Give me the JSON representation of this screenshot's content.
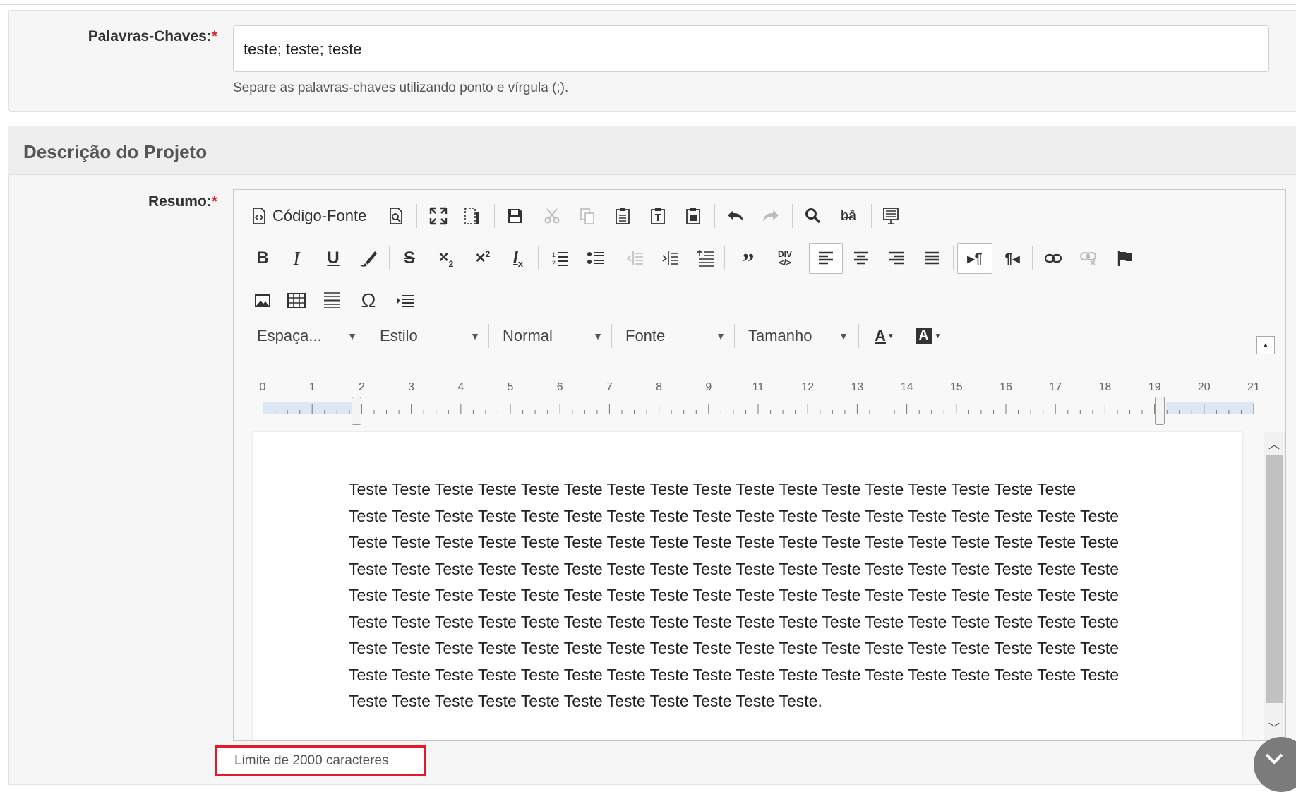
{
  "keywords": {
    "label": "Palavras-Chaves:",
    "required_mark": "*",
    "value": "teste; teste; teste",
    "help": "Separe as palavras-chaves utilizando ponto e vírgula (;)."
  },
  "section": {
    "title": "Descrição do Projeto"
  },
  "resumo": {
    "label": "Resumo:",
    "required_mark": "*",
    "limit_text": "Limite de 2000 caracteres"
  },
  "toolbar": {
    "source_label": "Código-Fonte",
    "combos": [
      {
        "label": "Espaça...",
        "name": "spacing-combo"
      },
      {
        "label": "Estilo",
        "name": "style-combo"
      },
      {
        "label": "Normal",
        "name": "format-combo"
      },
      {
        "label": "Fonte",
        "name": "font-combo"
      },
      {
        "label": "Tamanho",
        "name": "size-combo"
      }
    ]
  },
  "ruler": {
    "numbers": [
      "0",
      "1",
      "2",
      "3",
      "4",
      "5",
      "6",
      "7",
      "8",
      "9",
      "11",
      "12",
      "13",
      "14",
      "15",
      "16",
      "17",
      "18",
      "19",
      "20",
      "21"
    ]
  },
  "document": {
    "lines": [
      "Teste Teste Teste Teste Teste Teste Teste Teste Teste Teste Teste Teste Teste Teste Teste Teste Teste",
      "Teste Teste Teste Teste Teste Teste Teste Teste Teste Teste Teste Teste Teste Teste Teste Teste Teste Teste",
      "Teste Teste Teste Teste Teste Teste Teste Teste Teste Teste Teste Teste Teste Teste Teste Teste Teste Teste",
      "Teste Teste Teste Teste Teste Teste Teste Teste Teste Teste Teste Teste Teste Teste Teste Teste Teste Teste",
      "Teste Teste Teste Teste Teste Teste Teste Teste Teste Teste Teste Teste Teste Teste Teste Teste Teste Teste",
      "Teste Teste Teste Teste Teste Teste Teste Teste Teste Teste Teste Teste Teste Teste Teste Teste Teste Teste",
      "Teste Teste Teste Teste Teste Teste Teste Teste Teste Teste Teste Teste Teste Teste Teste Teste Teste Teste",
      "Teste Teste Teste Teste Teste Teste Teste Teste Teste Teste Teste Teste Teste Teste Teste Teste Teste Teste",
      "Teste Teste Teste Teste Teste Teste Teste Teste Teste Teste Teste."
    ]
  },
  "icons": {
    "preview": "preview-icon",
    "maximize": "maximize-icon",
    "save": "save-icon",
    "undo": "undo-icon",
    "find": "search-icon",
    "blockquote": "blockquote-icon",
    "special_char": "omega-icon",
    "scroll_down": "chevron-down-icon"
  },
  "colors": {
    "required": "#e02020",
    "highlight_border": "#e21b2b",
    "accent_ruler": "#dde8f4"
  }
}
